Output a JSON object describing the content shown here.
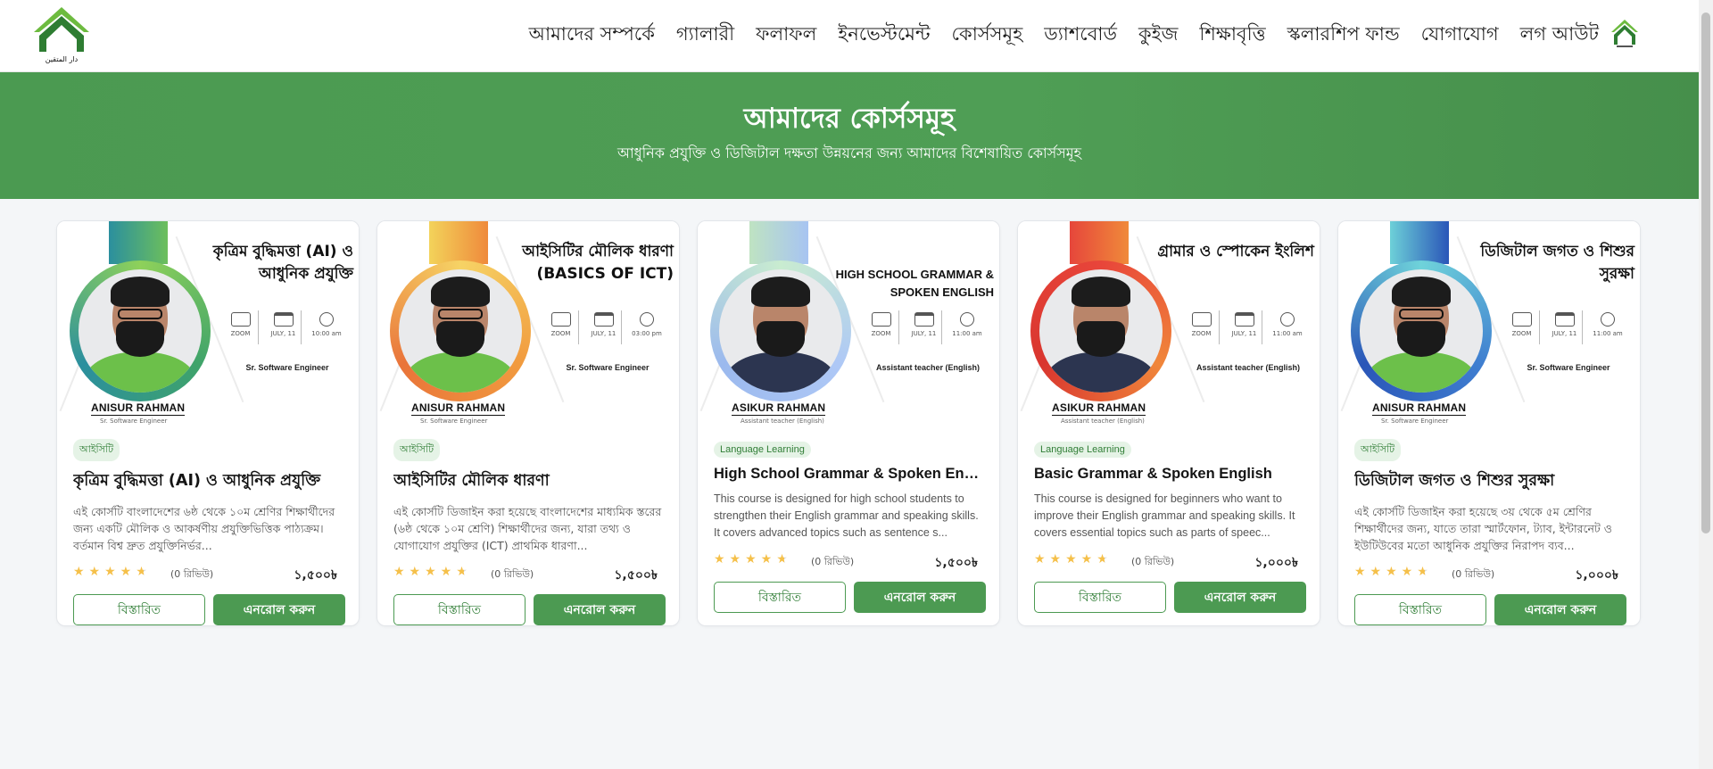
{
  "header": {
    "logo_text": "دار المتقين",
    "nav": [
      "আমাদের সম্পর্কে",
      "গ্যালারী",
      "ফলাফল",
      "ইনভেস্টমেন্ট",
      "কোর্সসমূহ",
      "ড্যাশবোর্ড",
      "কুইজ",
      "শিক্ষাবৃত্তি",
      "স্কলারশিপ ফান্ড",
      "যোগাযোগ",
      "লগ আউট"
    ]
  },
  "hero": {
    "title": "আমাদের কোর্সসমূহ",
    "subtitle": "আধুনিক প্রযুক্তি ও ডিজিটাল দক্ষতা উন্নয়নের জন্য আমাদের বিশেষায়িত কোর্সসমূহ"
  },
  "colors": {
    "brand_green": "#4c9a52",
    "star": "#f5c04a"
  },
  "meta_labels": {
    "platform": "ZOOM",
    "date": "JULY, 11"
  },
  "cards": [
    {
      "banner_title": "কৃত্রিম বুদ্ধিমত্তা (AI) ও আধুনিক প্রযুক্তি",
      "banner_time": "10:00 am",
      "banner_role": "Sr. Software Engineer",
      "instructor": "ANISUR RAHMAN",
      "instructor_sub": "Sr. Software Engineer",
      "tag": "আইসিটি",
      "title": "কৃত্রিম বুদ্ধিমত্তা (AI) ও আধুনিক প্রযুক্তি",
      "description": "এই কোর্সটি বাংলাদেশের ৬ষ্ঠ থেকে ১০ম শ্রেণির শিক্ষার্থীদের জন্য একটি মৌলিক ও আকর্ষণীয় প্রযুক্তিভিত্তিক পাঠ্যক্রম। বর্তমান বিশ্ব দ্রুত প্রযুক্তিনির্ভর...",
      "rating": 4.5,
      "reviews": "(0 রিভিউ)",
      "price": "১,৫০০৳",
      "details_label": "বিস্তারিত",
      "enroll_label": "এনরোল করুন"
    },
    {
      "banner_title": "আইসিটির মৌলিক ধারণা (BASICS OF ICT)",
      "banner_time": "03:00 pm",
      "banner_role": "Sr. Software Engineer",
      "instructor": "ANISUR RAHMAN",
      "instructor_sub": "Sr. Software Engineer",
      "tag": "আইসিটি",
      "title": "আইসিটির মৌলিক ধারণা",
      "description": "এই কোর্সটি ডিজাইন করা হয়েছে বাংলাদেশের মাধ্যমিক স্তরের (৬ষ্ঠ থেকে ১০ম শ্রেণি) শিক্ষার্থীদের জন্য, যারা তথ্য ও যোগাযোগ প্রযুক্তির (ICT) প্রাথমিক ধারণা...",
      "rating": 4.5,
      "reviews": "(0 রিভিউ)",
      "price": "১,৫০০৳",
      "details_label": "বিস্তারিত",
      "enroll_label": "এনরোল করুন"
    },
    {
      "banner_title": "HIGH SCHOOL GRAMMAR & SPOKEN ENGLISH",
      "banner_time": "11:00 am",
      "banner_role": "Assistant teacher (English)",
      "instructor": "ASIKUR RAHMAN",
      "instructor_sub": "Assistant teacher (English)",
      "tag": "Language Learning",
      "title": "High School Grammar & Spoken English",
      "description": "This course is designed for high school students to strengthen their English grammar and speaking skills. It covers advanced topics such as sentence s...",
      "rating": 4.5,
      "reviews": "(0 রিভিউ)",
      "price": "১,৫০০৳",
      "details_label": "বিস্তারিত",
      "enroll_label": "এনরোল করুন"
    },
    {
      "banner_title": "গ্রামার ও স্পোকেন ইংলিশ",
      "banner_time": "11:00 am",
      "banner_role": "Assistant teacher (English)",
      "instructor": "ASIKUR RAHMAN",
      "instructor_sub": "Assistant teacher (English)",
      "tag": "Language Learning",
      "title": "Basic Grammar & Spoken English",
      "description": "This course is designed for beginners who want to improve their English grammar and speaking skills. It covers essential topics such as parts of speec...",
      "rating": 4.5,
      "reviews": "(0 রিভিউ)",
      "price": "১,০০০৳",
      "details_label": "বিস্তারিত",
      "enroll_label": "এনরোল করুন"
    },
    {
      "banner_title": "ডিজিটাল জগত ও শিশুর সুরক্ষা",
      "banner_time": "11:00 am",
      "banner_role": "Sr. Software Engineer",
      "instructor": "ANISUR RAHMAN",
      "instructor_sub": "Sr. Software Engineer",
      "tag": "আইসিটি",
      "title": "ডিজিটাল জগত ও শিশুর সুরক্ষা",
      "description": "এই কোর্সটি ডিজাইন করা হয়েছে ৩য় থেকে ৫ম শ্রেণির শিক্ষার্থীদের জন্য, যাতে তারা স্মার্টফোন, ট্যাব, ইন্টারনেট ও ইউটিউবের মতো আধুনিক প্রযুক্তির নিরাপদ ব্যব...",
      "rating": 4.5,
      "reviews": "(0 রিভিউ)",
      "price": "১,০০০৳",
      "details_label": "বিস্তারিত",
      "enroll_label": "এনরোল করুন"
    }
  ]
}
